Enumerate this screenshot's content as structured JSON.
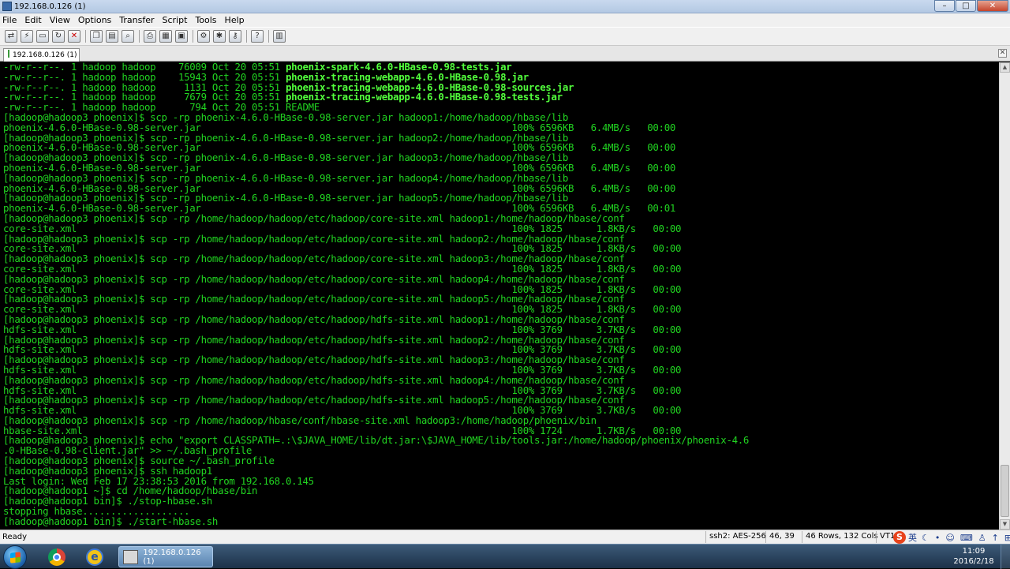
{
  "window": {
    "title": "192.168.0.126 (1)",
    "buttons": {
      "minimize": "–",
      "maximize": "□",
      "close": "✕"
    }
  },
  "menu": [
    "File",
    "Edit",
    "View",
    "Options",
    "Transfer",
    "Script",
    "Tools",
    "Help"
  ],
  "toolbar_icons": [
    "connect-icon",
    "quick-connect-icon",
    "connect-tab-icon",
    "reconnect-icon",
    "disconnect-icon",
    "copy-icon",
    "paste-icon",
    "find-icon",
    "print-icon",
    "print-setup-icon",
    "print-preview-icon",
    "session-options-icon",
    "global-options-icon",
    "keymap-icon",
    "help-icon",
    "sftp-icon"
  ],
  "tab": {
    "label": "192.168.0.126 (1)",
    "close": "✕"
  },
  "terminal": {
    "lines": [
      {
        "pre": "-rw-r--r--. 1 hadoop hadoop    76009 Oct 20 05:51 ",
        "hl": "phoenix-spark-4.6.0-HBase-0.98-tests.jar"
      },
      {
        "pre": "-rw-r--r--. 1 hadoop hadoop    15943 Oct 20 05:51 ",
        "hl": "phoenix-tracing-webapp-4.6.0-HBase-0.98.jar"
      },
      {
        "pre": "-rw-r--r--. 1 hadoop hadoop     1131 Oct 20 05:51 ",
        "hl": "phoenix-tracing-webapp-4.6.0-HBase-0.98-sources.jar"
      },
      {
        "pre": "-rw-r--r--. 1 hadoop hadoop     7679 Oct 20 05:51 ",
        "hl": "phoenix-tracing-webapp-4.6.0-HBase-0.98-tests.jar"
      },
      {
        "pre": "-rw-r--r--. 1 hadoop hadoop      794 Oct 20 05:51 README",
        "hl": ""
      },
      {
        "pre": "[hadoop@hadoop3 phoenix]$ scp -rp phoenix-4.6.0-HBase-0.98-server.jar hadoop1:/home/hadoop/hbase/lib",
        "hl": ""
      },
      {
        "pre": "phoenix-4.6.0-HBase-0.98-server.jar                                                       100% 6596KB   6.4MB/s   00:00",
        "hl": ""
      },
      {
        "pre": "[hadoop@hadoop3 phoenix]$ scp -rp phoenix-4.6.0-HBase-0.98-server.jar hadoop2:/home/hadoop/hbase/lib",
        "hl": ""
      },
      {
        "pre": "phoenix-4.6.0-HBase-0.98-server.jar                                                       100% 6596KB   6.4MB/s   00:00",
        "hl": ""
      },
      {
        "pre": "[hadoop@hadoop3 phoenix]$ scp -rp phoenix-4.6.0-HBase-0.98-server.jar hadoop3:/home/hadoop/hbase/lib",
        "hl": ""
      },
      {
        "pre": "phoenix-4.6.0-HBase-0.98-server.jar                                                       100% 6596KB   6.4MB/s   00:00",
        "hl": ""
      },
      {
        "pre": "[hadoop@hadoop3 phoenix]$ scp -rp phoenix-4.6.0-HBase-0.98-server.jar hadoop4:/home/hadoop/hbase/lib",
        "hl": ""
      },
      {
        "pre": "phoenix-4.6.0-HBase-0.98-server.jar                                                       100% 6596KB   6.4MB/s   00:00",
        "hl": ""
      },
      {
        "pre": "[hadoop@hadoop3 phoenix]$ scp -rp phoenix-4.6.0-HBase-0.98-server.jar hadoop5:/home/hadoop/hbase/lib",
        "hl": ""
      },
      {
        "pre": "phoenix-4.6.0-HBase-0.98-server.jar                                                       100% 6596KB   6.4MB/s   00:01",
        "hl": ""
      },
      {
        "pre": "[hadoop@hadoop3 phoenix]$ scp -rp /home/hadoop/hadoop/etc/hadoop/core-site.xml hadoop1:/home/hadoop/hbase/conf",
        "hl": ""
      },
      {
        "pre": "core-site.xml                                                                             100% 1825      1.8KB/s   00:00",
        "hl": ""
      },
      {
        "pre": "[hadoop@hadoop3 phoenix]$ scp -rp /home/hadoop/hadoop/etc/hadoop/core-site.xml hadoop2:/home/hadoop/hbase/conf",
        "hl": ""
      },
      {
        "pre": "core-site.xml                                                                             100% 1825      1.8KB/s   00:00",
        "hl": ""
      },
      {
        "pre": "[hadoop@hadoop3 phoenix]$ scp -rp /home/hadoop/hadoop/etc/hadoop/core-site.xml hadoop3:/home/hadoop/hbase/conf",
        "hl": ""
      },
      {
        "pre": "core-site.xml                                                                             100% 1825      1.8KB/s   00:00",
        "hl": ""
      },
      {
        "pre": "[hadoop@hadoop3 phoenix]$ scp -rp /home/hadoop/hadoop/etc/hadoop/core-site.xml hadoop4:/home/hadoop/hbase/conf",
        "hl": ""
      },
      {
        "pre": "core-site.xml                                                                             100% 1825      1.8KB/s   00:00",
        "hl": ""
      },
      {
        "pre": "[hadoop@hadoop3 phoenix]$ scp -rp /home/hadoop/hadoop/etc/hadoop/core-site.xml hadoop5:/home/hadoop/hbase/conf",
        "hl": ""
      },
      {
        "pre": "core-site.xml                                                                             100% 1825      1.8KB/s   00:00",
        "hl": ""
      },
      {
        "pre": "[hadoop@hadoop3 phoenix]$ scp -rp /home/hadoop/hadoop/etc/hadoop/hdfs-site.xml hadoop1:/home/hadoop/hbase/conf",
        "hl": ""
      },
      {
        "pre": "hdfs-site.xml                                                                             100% 3769      3.7KB/s   00:00",
        "hl": ""
      },
      {
        "pre": "[hadoop@hadoop3 phoenix]$ scp -rp /home/hadoop/hadoop/etc/hadoop/hdfs-site.xml hadoop2:/home/hadoop/hbase/conf",
        "hl": ""
      },
      {
        "pre": "hdfs-site.xml                                                                             100% 3769      3.7KB/s   00:00",
        "hl": ""
      },
      {
        "pre": "[hadoop@hadoop3 phoenix]$ scp -rp /home/hadoop/hadoop/etc/hadoop/hdfs-site.xml hadoop3:/home/hadoop/hbase/conf",
        "hl": ""
      },
      {
        "pre": "hdfs-site.xml                                                                             100% 3769      3.7KB/s   00:00",
        "hl": ""
      },
      {
        "pre": "[hadoop@hadoop3 phoenix]$ scp -rp /home/hadoop/hadoop/etc/hadoop/hdfs-site.xml hadoop4:/home/hadoop/hbase/conf",
        "hl": ""
      },
      {
        "pre": "hdfs-site.xml                                                                             100% 3769      3.7KB/s   00:00",
        "hl": ""
      },
      {
        "pre": "[hadoop@hadoop3 phoenix]$ scp -rp /home/hadoop/hadoop/etc/hadoop/hdfs-site.xml hadoop5:/home/hadoop/hbase/conf",
        "hl": ""
      },
      {
        "pre": "hdfs-site.xml                                                                             100% 3769      3.7KB/s   00:00",
        "hl": ""
      },
      {
        "pre": "[hadoop@hadoop3 phoenix]$ scp -rp /home/hadoop/hbase/conf/hbase-site.xml hadoop3:/home/hadoop/phoenix/bin",
        "hl": ""
      },
      {
        "pre": "hbase-site.xml                                                                            100% 1724      1.7KB/s   00:00",
        "hl": ""
      },
      {
        "pre": "[hadoop@hadoop3 phoenix]$ echo \"export CLASSPATH=.:\\$JAVA_HOME/lib/dt.jar:\\$JAVA_HOME/lib/tools.jar:/home/hadoop/phoenix/phoenix-4.6",
        "hl": ""
      },
      {
        "pre": ".0-HBase-0.98-client.jar\" >> ~/.bash_profile",
        "hl": ""
      },
      {
        "pre": "[hadoop@hadoop3 phoenix]$ source ~/.bash_profile",
        "hl": ""
      },
      {
        "pre": "[hadoop@hadoop3 phoenix]$ ssh hadoop1",
        "hl": ""
      },
      {
        "pre": "Last login: Wed Feb 17 23:38:53 2016 from 192.168.0.145",
        "hl": ""
      },
      {
        "pre": "[hadoop@hadoop1 ~]$ cd /home/hadoop/hbase/bin",
        "hl": ""
      },
      {
        "pre": "[hadoop@hadoop1 bin]$ ./stop-hbase.sh",
        "hl": ""
      },
      {
        "pre": "stopping hbase...................",
        "hl": ""
      },
      {
        "pre": "[hadoop@hadoop1 bin]$ ./start-hbase.sh",
        "hl": ""
      }
    ]
  },
  "status": {
    "ready": "Ready",
    "cipher": "ssh2: AES-256",
    "cursor": "46,  39",
    "size": "46 Rows, 132 Cols",
    "term": "VT1"
  },
  "ime": {
    "logo": "S",
    "lang": "英",
    "icons": [
      "moon-icon",
      "dot-icon",
      "smile-icon",
      "keyboard-icon",
      "shirt-icon",
      "up-arrow-icon",
      "grid-icon"
    ]
  },
  "taskbar": {
    "window_label": "192.168.0.126 (1)",
    "time": "11:09",
    "date": "2016/2/18"
  },
  "colors": {
    "terminal_fg": "#21d421",
    "terminal_highlight": "#52ff3c",
    "terminal_bg": "#000000"
  }
}
